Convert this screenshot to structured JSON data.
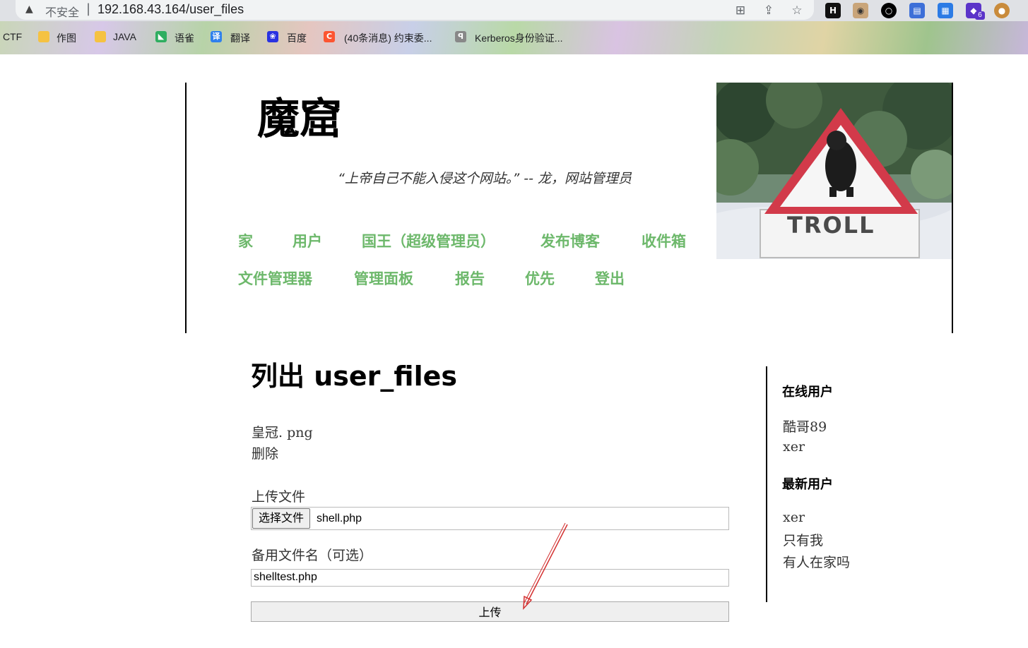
{
  "browser": {
    "security_label": "不安全",
    "url": "192.168.43.164/user_files",
    "bookmarks": [
      "CTF",
      "作图",
      "JAVA",
      "语雀",
      "翻译",
      "百度",
      "(40条消息) 约束委...",
      "Kerberos身份验证..."
    ],
    "extension_badge": "6",
    "colors": {
      "chrome": "#dfe1e5",
      "urlbar": "#f1f3f4"
    }
  },
  "site": {
    "title": "魔窟",
    "tagline": "“上帝自己不能入侵这个网站。” -- 龙，网站管理员",
    "nav": [
      "家",
      "用户",
      "国王（超级管理员）",
      "发布博客",
      "收件箱",
      "文件管理器",
      "管理面板",
      "报告",
      "优先",
      "登出"
    ],
    "banner_text": "TROLL",
    "accent_color": "#6db86b"
  },
  "main": {
    "title": "列出 user_files",
    "file_name": "皇冠. png",
    "delete_label": "删除",
    "upload_label": "上传文件",
    "choose_button": "选择文件",
    "chosen_file": "shell.php",
    "alt_name_label": "备用文件名（可选）",
    "alt_name_value": "shelltest.php",
    "submit_label": "上传"
  },
  "sidebar": {
    "online_title": "在线用户",
    "online_users": [
      "酷哥89",
      "xer"
    ],
    "newest_title": "最新用户",
    "newest_users": [
      "xer",
      "只有我",
      "有人在家吗"
    ]
  },
  "annotation": {
    "arrow_color": "#d32f2f"
  }
}
